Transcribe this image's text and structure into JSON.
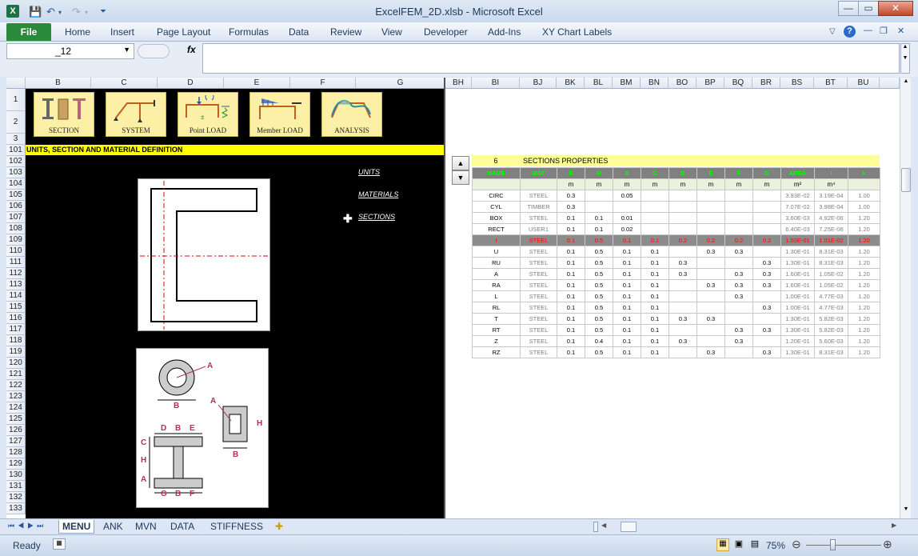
{
  "window": {
    "title": "ExcelFEM_2D.xlsb  -  Microsoft Excel",
    "icon": "excel-icon"
  },
  "qat": {
    "save": "save-icon",
    "undo": "undo-icon",
    "redo": "redo-icon"
  },
  "ribbon": {
    "file": "File",
    "tabs": [
      "Home",
      "Insert",
      "Page Layout",
      "Formulas",
      "Data",
      "Review",
      "View",
      "Developer",
      "Add-Ins",
      "XY Chart Labels"
    ]
  },
  "formula_bar": {
    "name_box": "_12",
    "fx": "fx",
    "value": ""
  },
  "columns_left": [
    "B",
    "C",
    "D",
    "E",
    "F",
    "G"
  ],
  "columns_right": [
    "BH",
    "BI",
    "BJ",
    "BK",
    "BL",
    "BM",
    "BN",
    "BO",
    "BP",
    "BQ",
    "BR",
    "BS",
    "BT",
    "BU"
  ],
  "rows": [
    "1",
    "2",
    "3",
    "101",
    "102",
    "103",
    "104",
    "105",
    "106",
    "107",
    "108",
    "109",
    "110",
    "111",
    "112",
    "113",
    "114",
    "115",
    "116",
    "117",
    "118",
    "119",
    "120",
    "121",
    "122",
    "123",
    "124",
    "125",
    "126",
    "127",
    "128",
    "129",
    "130",
    "131",
    "132",
    "133"
  ],
  "menu_buttons": [
    {
      "label": "SECTION"
    },
    {
      "label": "SYSTEM"
    },
    {
      "label": "Point  LOAD"
    },
    {
      "label": "Member LOAD"
    },
    {
      "label": "ANALYSIS"
    }
  ],
  "banner": "UNITS, SECTION AND MATERIAL DEFINITION",
  "links": {
    "units": "UNITS",
    "materials": "MATERIALS",
    "sections": "SECTIONS"
  },
  "diagram_labels": {
    "a": "A",
    "b": "B",
    "c": "C",
    "d": "D",
    "e": "E",
    "f": "F",
    "g": "G",
    "h": "H"
  },
  "sections": {
    "count": "6",
    "title": "SECTIONS PROPERTIES",
    "headers": [
      "NAME",
      "MAT",
      "B",
      "H",
      "A",
      "C",
      "D",
      "E",
      "F",
      "G",
      "AREA",
      "I",
      "k"
    ],
    "units": [
      "",
      "",
      "m",
      "m",
      "m",
      "m",
      "m",
      "m",
      "m",
      "m",
      "m²",
      "m⁴",
      ""
    ],
    "rows": [
      [
        "CIRC",
        "STEEL",
        "0.3",
        "",
        "0.05",
        "",
        "",
        "",
        "",
        "",
        "3.93E-02",
        "3.19E-04",
        "1.00"
      ],
      [
        "CYL",
        "TIMBER",
        "0.3",
        "",
        "",
        "",
        "",
        "",
        "",
        "",
        "7.07E-02",
        "3.98E-04",
        "1.00"
      ],
      [
        "BOX",
        "STEEL",
        "0.1",
        "0.1",
        "0.01",
        "",
        "",
        "",
        "",
        "",
        "3.60E-03",
        "4.92E-06",
        "1.20"
      ],
      [
        "RECT",
        "USER1",
        "0.1",
        "0.1",
        "0.02",
        "",
        "",
        "",
        "",
        "",
        "6.40E-03",
        "7.25E-06",
        "1.20"
      ],
      [
        "I",
        "STEEL",
        "0.1",
        "0.5",
        "0.1",
        "0.1",
        "0.2",
        "0.2",
        "0.2",
        "0.2",
        "1.50E-01",
        "1.01E-02",
        "1.20"
      ],
      [
        "U",
        "STEEL",
        "0.1",
        "0.5",
        "0.1",
        "0.1",
        "",
        "0.3",
        "0.3",
        "",
        "1.30E-01",
        "8.31E-03",
        "1.20"
      ],
      [
        "RU",
        "STEEL",
        "0.1",
        "0.5",
        "0.1",
        "0.1",
        "0.3",
        "",
        "",
        "0.3",
        "1.30E-01",
        "8.31E-03",
        "1.20"
      ],
      [
        "A",
        "STEEL",
        "0.1",
        "0.5",
        "0.1",
        "0.1",
        "0.3",
        "",
        "0.3",
        "0.3",
        "1.60E-01",
        "1.05E-02",
        "1.20"
      ],
      [
        "RA",
        "STEEL",
        "0.1",
        "0.5",
        "0.1",
        "0.1",
        "",
        "0.3",
        "0.3",
        "0.3",
        "1.60E-01",
        "1.05E-02",
        "1.20"
      ],
      [
        "L",
        "STEEL",
        "0.1",
        "0.5",
        "0.1",
        "0.1",
        "",
        "",
        "0.3",
        "",
        "1.00E-01",
        "4.77E-03",
        "1.20"
      ],
      [
        "RL",
        "STEEL",
        "0.1",
        "0.5",
        "0.1",
        "0.1",
        "",
        "",
        "",
        "0.3",
        "1.00E-01",
        "4.77E-03",
        "1.20"
      ],
      [
        "T",
        "STEEL",
        "0.1",
        "0.5",
        "0.1",
        "0.1",
        "0.3",
        "0.3",
        "",
        "",
        "1.30E-01",
        "5.82E-03",
        "1.20"
      ],
      [
        "RT",
        "STEEL",
        "0.1",
        "0.5",
        "0.1",
        "0.1",
        "",
        "",
        "0.3",
        "0.3",
        "1.30E-01",
        "5.82E-03",
        "1.20"
      ],
      [
        "Z",
        "STEEL",
        "0.1",
        "0.4",
        "0.1",
        "0.1",
        "0.3",
        "",
        "0.3",
        "",
        "1.20E-01",
        "5.60E-03",
        "1.20"
      ],
      [
        "RZ",
        "STEEL",
        "0.1",
        "0.5",
        "0.1",
        "0.1",
        "",
        "0.3",
        "",
        "0.3",
        "1.30E-01",
        "8.31E-03",
        "1.20"
      ]
    ],
    "selected_row": 4
  },
  "sheet_tabs": [
    "MENU",
    "ANK",
    "MVN",
    "DATA",
    "STIFFNESS"
  ],
  "active_sheet": "MENU",
  "status": {
    "ready": "Ready",
    "zoom": "75%"
  },
  "colors": {
    "accent": "#2a8a3c",
    "banner": "#ffff00",
    "button": "#fbf0a5",
    "header_green": "#00ff00"
  }
}
